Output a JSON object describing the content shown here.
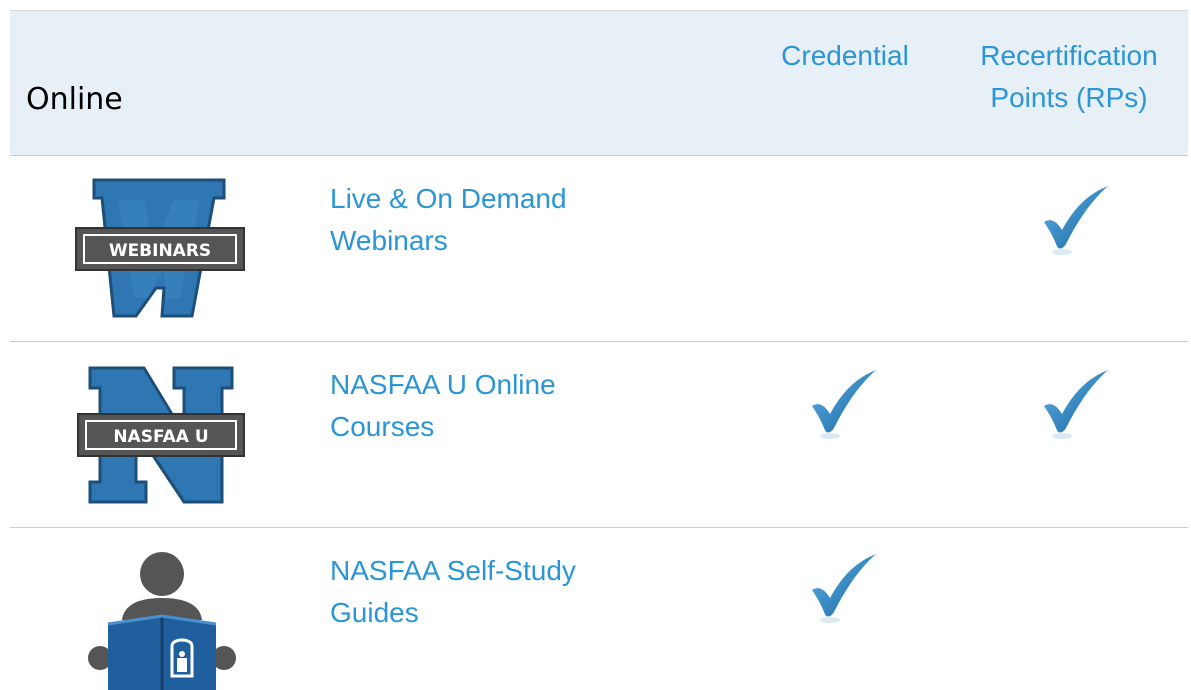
{
  "header": {
    "section_title": "Online",
    "columns": {
      "credential": "Credential",
      "rp_line1": "Recertification",
      "rp_line2": "Points (RPs)"
    }
  },
  "rows": [
    {
      "title_line1": "Live & On Demand",
      "title_line2": "Webinars",
      "icon_label": "WEBINARS",
      "icon": "webinars-w-badge-icon",
      "credential": false,
      "recertification_points": true
    },
    {
      "title_line1": "NASFAA U Online",
      "title_line2": "Courses",
      "icon_label": "NASFAA U",
      "icon": "nasfaa-u-n-badge-icon",
      "credential": true,
      "recertification_points": true
    },
    {
      "title_line1": "NASFAA Self-Study",
      "title_line2": "Guides",
      "icon": "person-reading-book-icon",
      "credential": true,
      "recertification_points": false
    }
  ],
  "colors": {
    "link": "#2b95d6",
    "header_bg": "#e7eff7",
    "badge_blue": "#2f77b3",
    "badge_gray": "#555555",
    "check": "#1b79bf"
  }
}
